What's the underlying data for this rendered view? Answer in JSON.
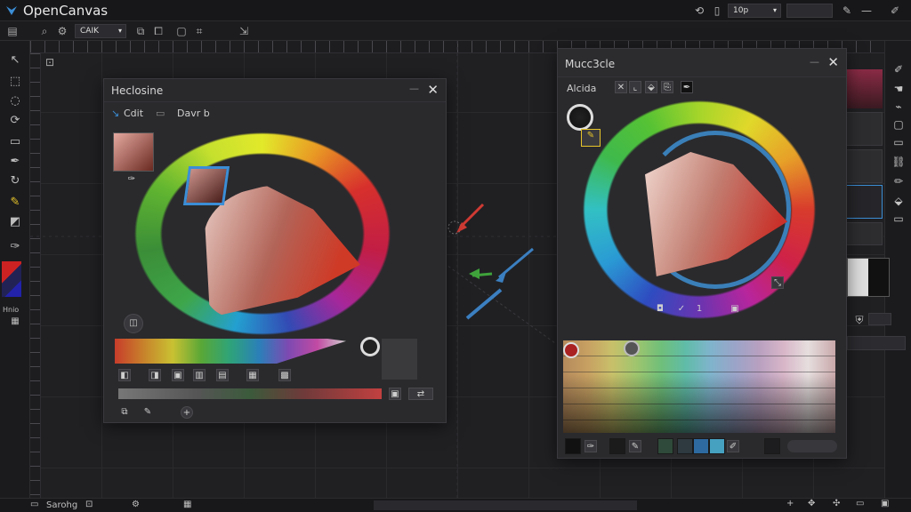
{
  "app": {
    "title": "OpenCanvas"
  },
  "titlebar": {
    "zoom_value": "10p",
    "zoom_chev": "▾"
  },
  "toolbar": {
    "mode_value": "CAIK",
    "mode_chev": "▾"
  },
  "left_panel": {
    "title": "Heclosine",
    "tab_edit": "Cdit",
    "tab_draw": "Davr b"
  },
  "right_panel": {
    "title": "Mucc3cle",
    "subtitle": "Alcida"
  },
  "left_tools": {
    "label_a": "Hnio"
  },
  "status": {
    "text": "Sarohg"
  },
  "icons": {
    "select": "↖",
    "lasso": "◌",
    "brush": "✎",
    "fill": "⬚",
    "zoom": "⌕",
    "gear": "⚙",
    "close": "✕",
    "minus": "—"
  },
  "colors": {
    "accent": "#3b8ed6",
    "titlebar": "#17171a",
    "panel": "#2a2a2d",
    "arrow_red": "#d03a33",
    "arrow_green": "#3fa33b",
    "arrow_blue": "#3b7fc0",
    "highlight_yellow": "#e7c52a"
  }
}
